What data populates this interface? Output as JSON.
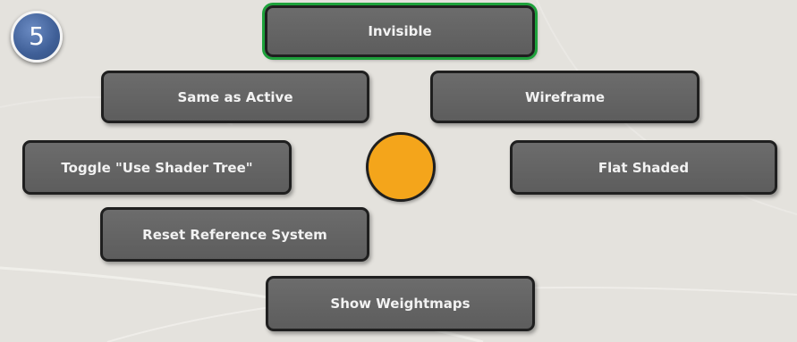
{
  "step_badge": {
    "label": "5",
    "color": "#3f5f97"
  },
  "pie_menu": {
    "items": [
      {
        "label": "Invisible",
        "active": true
      },
      {
        "label": "Same as Active"
      },
      {
        "label": "Wireframe"
      },
      {
        "label": "Toggle \"Use Shader Tree\""
      },
      {
        "label": "Flat Shaded"
      },
      {
        "label": "Reset Reference System"
      },
      {
        "label": "Show Weightmaps"
      }
    ],
    "active_highlight_color": "#1ea13b",
    "center_color": "#f4a51b"
  }
}
